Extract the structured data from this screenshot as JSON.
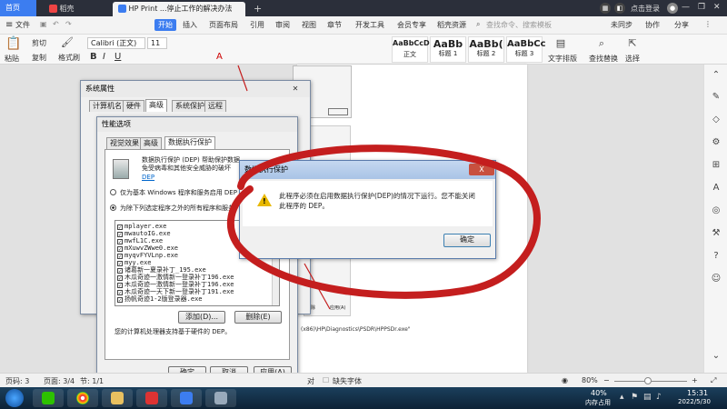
{
  "browser_tabs": {
    "home": "首页",
    "daoke": "稻壳",
    "doc": "HP Print ...停止工作的解决办法",
    "new_tab": "+"
  },
  "account": {
    "login": "点击登录"
  },
  "menu": {
    "file": "文件",
    "items": [
      "开始",
      "插入",
      "页面布局",
      "引用",
      "审阅",
      "视图",
      "章节",
      "开发工具",
      "会员专享",
      "稻壳资源"
    ],
    "search_placeholder": "查找命令、搜索模板",
    "cloud": "未同步",
    "collab": "协作",
    "share": "分享"
  },
  "ribbon": {
    "cut": "剪切",
    "copy": "复制",
    "format_painter": "格式刷",
    "paste": "粘贴",
    "font_name": "Calibri (正文)",
    "font_size": "11",
    "styles": [
      {
        "preview": "AaBbCcDd",
        "label": "正文"
      },
      {
        "preview": "AaBb",
        "label": "标题 1"
      },
      {
        "preview": "AaBb(",
        "label": "标题 2"
      },
      {
        "preview": "AaBbCc",
        "label": "标题 3"
      }
    ],
    "text_layout": "文字排版",
    "find_replace": "查找替换",
    "select": "选择"
  },
  "sys_props": {
    "title": "系统属性",
    "tabs": [
      "计算机名",
      "硬件",
      "高级",
      "系统保护",
      "远程"
    ]
  },
  "perf_options": {
    "title": "性能选项",
    "tabs": [
      "视觉效果",
      "高级",
      "数据执行保护"
    ],
    "description": "数据执行保护 (DEP) 帮助保护数据免受病毒和其他安全威胁的破坏",
    "link": "DEP",
    "radio_essential": "仅为基本 Windows 程序和服务启用 DEP",
    "radio_all": "为除下列选定程序之外的所有程序和服务",
    "programs": [
      "mplayer.exe",
      "mwautoIG.exe",
      "mwfL1C.exe",
      "mXuwvZWwe0.exe",
      "myqvFYVLnp.exe",
      "myy.exe",
      "诸葛新一夏录补丁_195.exe",
      "木瓜奇迹一激情新一登录补丁196.exe",
      "木瓜奇迹一激情新一登录补丁196.exe",
      "木瓜奇迹一天下新一登录补丁191.exe",
      "扬帆奇迹1-2版登录器.exe"
    ],
    "add_button": "添加(D)...",
    "remove_button": "删除(E)",
    "support_text": "您的计算机处理器支持基于硬件的 DEP。",
    "ok": "确定",
    "cancel": "取消",
    "apply": "应用(A)"
  },
  "dep_dialog": {
    "title": "数据执行保护",
    "close": "X",
    "message": "此程序必须在启用数据执行保护(DEP)的情况下运行。您不能关闭此程序的 DEP。",
    "ok": "确定"
  },
  "doc": {
    "path_text": "(x86)\\HP\\Diagnostics\\PSDR\\HPPSDr.exe\"",
    "side_btns": [
      "删除",
      "应用(A)"
    ]
  },
  "statusbar": {
    "page": "页码: 3",
    "pages": "页面: 3/4",
    "section": "节: 1/1",
    "check": "对",
    "missing_font": "缺失字体",
    "zoom": "80%"
  },
  "tray": {
    "cpu": "40%",
    "cpu_label": "内存占用",
    "time": "15:31",
    "date": "2022/5/30"
  },
  "colors": {
    "accent": "#3c7df0",
    "annotation": "#c41e1e"
  }
}
